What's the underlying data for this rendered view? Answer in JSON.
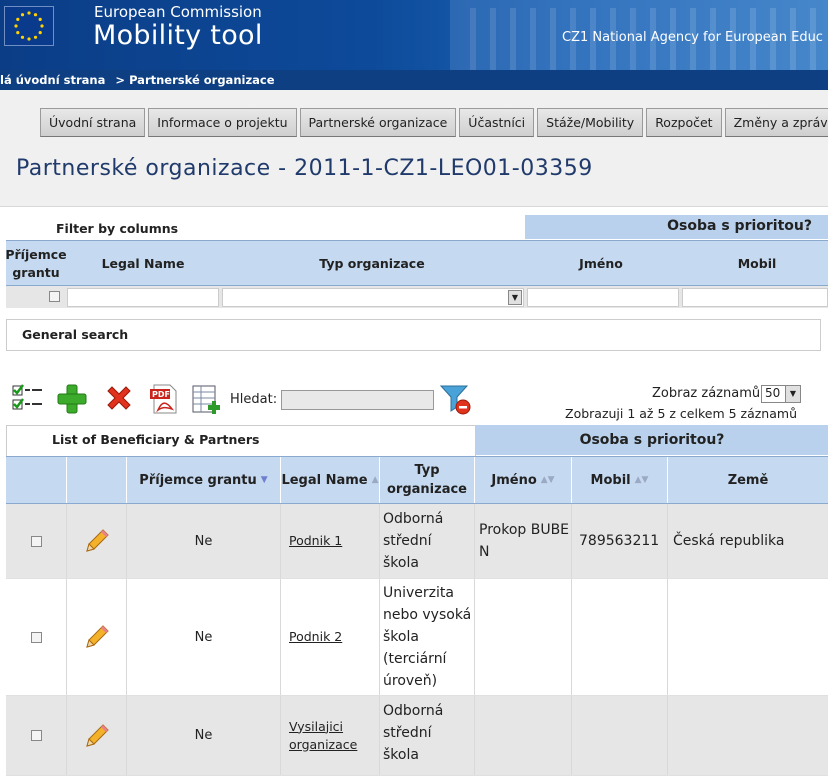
{
  "header": {
    "org_name": "European Commission",
    "app_name": "Mobility tool",
    "agency": "CZ1 National Agency for European Educ"
  },
  "breadcrumb": {
    "home": "lá úvodní strana",
    "separator": ">",
    "current": "Partnerské organizace"
  },
  "nav": {
    "tabs": [
      "Úvodní strana",
      "Informace o projektu",
      "Partnerské organizace",
      "Účastníci",
      "Stáže/Mobility",
      "Rozpočet",
      "Změny a zprávy"
    ]
  },
  "page": {
    "title": "Partnerské organizace - 2011-1-CZ1-LEO01-03359"
  },
  "filter": {
    "title": "Filter by columns",
    "priority_group": "Osoba s prioritou?",
    "col_grant_line1": "Příjemce",
    "col_grant_line2": "grantu",
    "col_legal_name": "Legal Name",
    "col_type": "Typ organizace",
    "col_name": "Jméno",
    "col_mobile": "Mobil",
    "general_search": "General search"
  },
  "toolbar": {
    "search_label": "Hledat:",
    "search_value": "",
    "show_label": "Zobraz záznamů",
    "show_value": "50",
    "summary": "Zobrazuji 1 až 5 z celkem 5 záznamů"
  },
  "table": {
    "title": "List of Beneficiary & Partners",
    "priority_group": "Osoba s prioritou?",
    "headers": {
      "grant": "Příjemce grantu",
      "legal_name": "Legal Name",
      "type_line1": "Typ",
      "type_line2": "organizace",
      "name": "Jméno",
      "mobile": "Mobil",
      "country": "Země"
    },
    "rows": [
      {
        "grant": "Ne",
        "legal_name_lines": [
          "Podnik 1"
        ],
        "type_lines": [
          "Odborná",
          "střední",
          "škola"
        ],
        "name_lines": [
          "Prokop BUBE",
          "N"
        ],
        "mobile": "789563211",
        "country": "Česká republika"
      },
      {
        "grant": "Ne",
        "legal_name_lines": [
          "Podnik 2"
        ],
        "type_lines": [
          "Univerzita",
          "nebo vysoká",
          "škola",
          "(terciární",
          "úroveň)"
        ],
        "name_lines": [],
        "mobile": "",
        "country": ""
      },
      {
        "grant": "Ne",
        "legal_name_lines": [
          "Vysilajici",
          "organizace"
        ],
        "type_lines": [
          "Odborná",
          "střední",
          "škola"
        ],
        "name_lines": [],
        "mobile": "",
        "country": ""
      }
    ]
  }
}
